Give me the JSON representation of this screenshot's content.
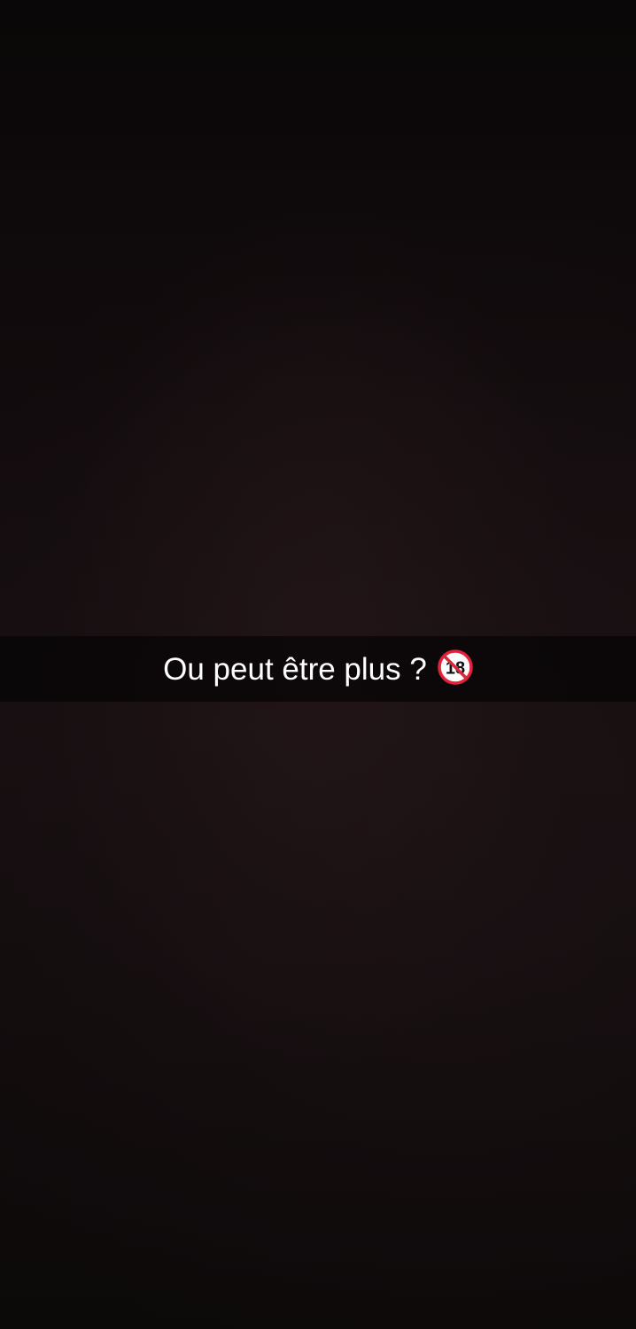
{
  "snap": {
    "caption": "Ou peut être plus ?",
    "emoji_icon": "no-one-under-eighteen-icon",
    "emoji_number": "18"
  },
  "colors": {
    "background": "#120c0d",
    "caption_bar": "#080506",
    "caption_text": "#ffffff",
    "emoji_red": "#e0223a"
  }
}
